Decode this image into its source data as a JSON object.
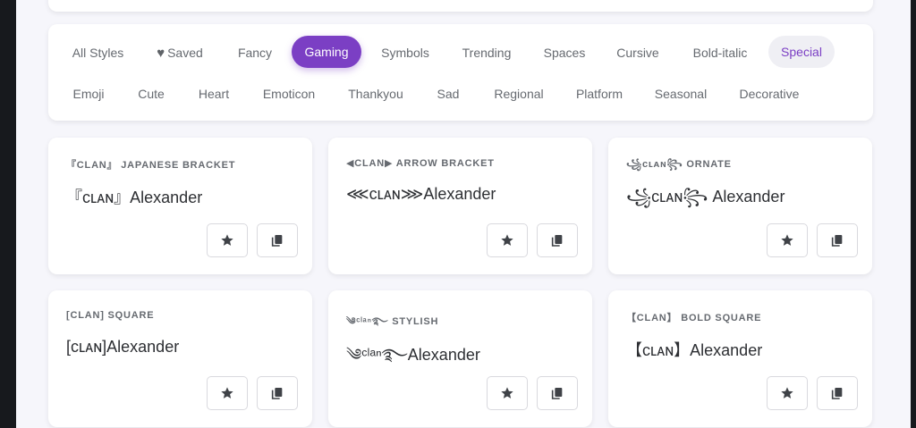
{
  "filters": [
    {
      "label": "All Styles"
    },
    {
      "label": "Saved"
    },
    {
      "label": "Fancy"
    },
    {
      "label": "Gaming"
    },
    {
      "label": "Symbols"
    },
    {
      "label": "Trending"
    },
    {
      "label": "Spaces"
    },
    {
      "label": "Cursive"
    },
    {
      "label": "Bold-italic"
    },
    {
      "label": "Special"
    },
    {
      "label": "Emoji"
    },
    {
      "label": "Cute"
    },
    {
      "label": "Heart"
    },
    {
      "label": "Emoticon"
    },
    {
      "label": "Thankyou"
    },
    {
      "label": "Sad"
    },
    {
      "label": "Regional"
    },
    {
      "label": "Platform"
    },
    {
      "label": "Seasonal"
    },
    {
      "label": "Decorative"
    }
  ],
  "active_filter": "Gaming",
  "highlighted_filter": "Special",
  "cards": [
    {
      "label": "『CLAN』 Japanese Bracket",
      "preview": "『ᴄʟᴀɴ』Alexander"
    },
    {
      "label": "◀CLAN▶ Arrow Bracket",
      "preview": "⋘ᴄʟᴀɴ⋙Alexander"
    },
    {
      "label": "꧁ᴄʟᴀɴ꧂ Ornate",
      "preview": "꧁ᴄʟᴀɴ꧂ Alexander"
    },
    {
      "label": "[CLAN] Square",
      "preview": "[ᴄʟᴀɴ]Alexander"
    },
    {
      "label": "༄ᶜˡᵃⁿ࿐ Stylish",
      "preview": "༄ᶜˡᵃⁿ࿐Alexander"
    },
    {
      "label": "【CLAN】 Bold Square",
      "preview": "【ᴄʟᴀɴ】Alexander"
    }
  ],
  "icons": {
    "saved": "heart-icon",
    "favorite": "star-icon",
    "copy": "copy-icon"
  },
  "colors": {
    "accent": "#7b3fc4",
    "background": "#f6f6fb",
    "card": "#ffffff"
  }
}
